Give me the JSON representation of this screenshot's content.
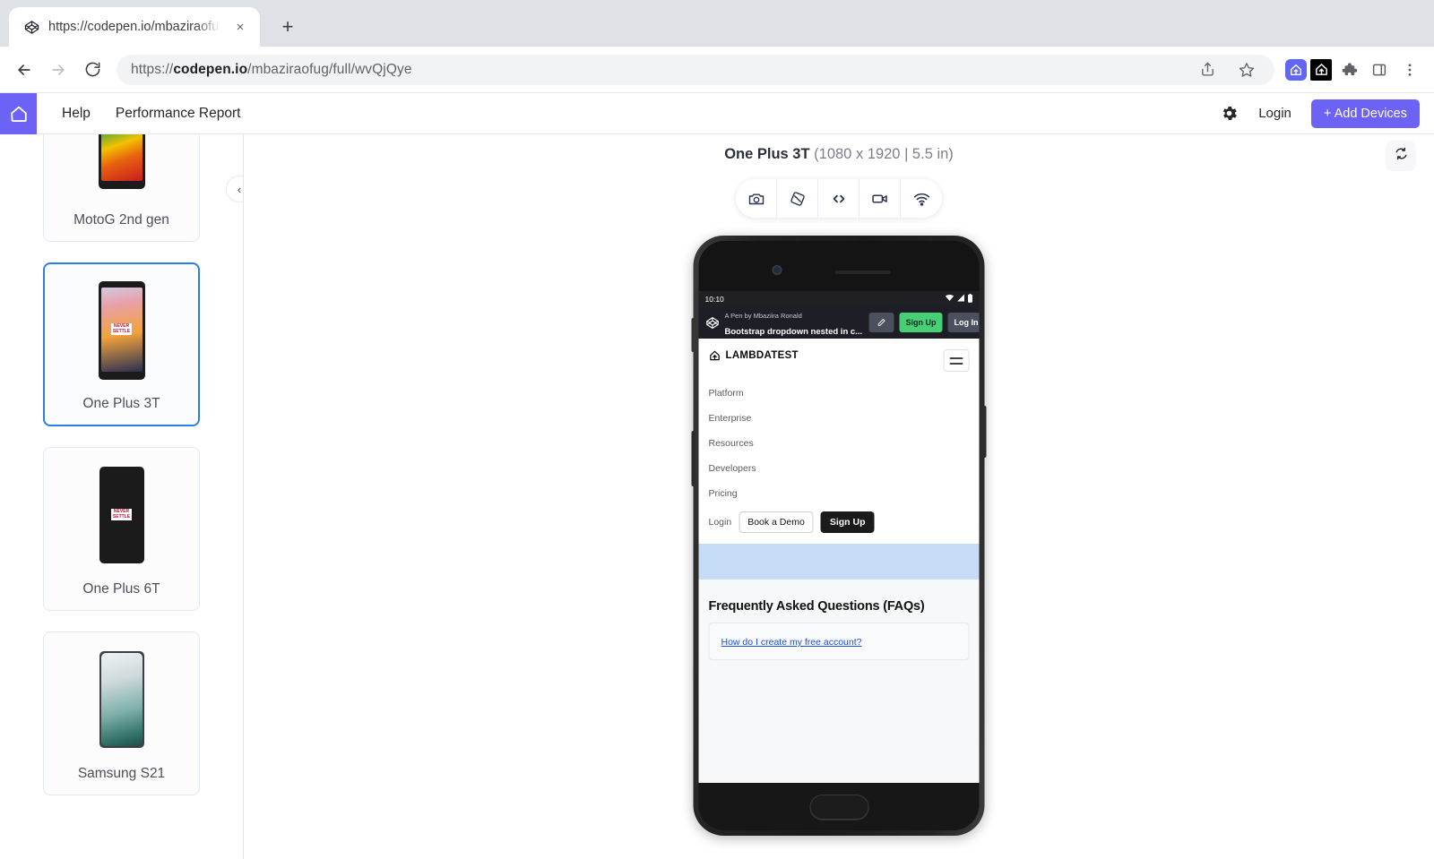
{
  "browser": {
    "tab": {
      "title": "https://codepen.io/mbaziraofug",
      "favicon": "codepen-icon",
      "close": "×"
    },
    "new_tab": "+",
    "nav": {
      "back": "←",
      "forward": "→",
      "reload": "⟳"
    },
    "address": {
      "prefix": "https://",
      "host": "codepen.io",
      "path": "/mbaziraofug/full/wvQjQye"
    },
    "actions": [
      "share-icon",
      "bookmark-star-icon",
      "lambdatest-extension-icon",
      "lambdatest-app-icon",
      "extensions-puzzle-icon",
      "side-panel-icon",
      "chrome-menu-icon"
    ]
  },
  "app_header": {
    "home_icon": "home-icon",
    "links": [
      "Help",
      "Performance Report"
    ],
    "settings_icon": "gear-icon",
    "login_label": "Login",
    "add_devices_label": "+ Add Devices",
    "accent": "#6c63f6"
  },
  "sidebar": {
    "collapse_icon": "‹",
    "devices": [
      {
        "label": "MotoG 2nd gen",
        "selected": false
      },
      {
        "label": "One Plus 3T",
        "selected": true
      },
      {
        "label": "One Plus 6T",
        "selected": false
      },
      {
        "label": "Samsung S21",
        "selected": false
      }
    ]
  },
  "stage": {
    "device_name": "One Plus 3T",
    "device_spec": "(1080 x 1920 | 5.5 in)",
    "toolbar": [
      {
        "name": "screenshot-icon",
        "label": "camera"
      },
      {
        "name": "rotate-icon",
        "label": "rotate"
      },
      {
        "name": "devtools-code-icon",
        "label": "<>"
      },
      {
        "name": "record-video-icon",
        "label": "video"
      },
      {
        "name": "network-wifi-icon",
        "label": "wifi"
      }
    ],
    "refresh_icon": "refresh-icon"
  },
  "device_screen": {
    "status_bar": {
      "time": "10:10",
      "icons": [
        "wifi-icon",
        "signal-icon",
        "battery-icon"
      ]
    },
    "codepen_bar": {
      "author": "A Pen by Mbaziira Ronald",
      "title": "Bootstrap dropdown nested in c...",
      "edit_label": "✎",
      "signup_label": "Sign Up",
      "login_label": "Log In",
      "signup_color": "#47cf73"
    },
    "site": {
      "logo_text": "LAMBDATEST",
      "menu": [
        "Platform",
        "Enterprise",
        "Resources",
        "Developers",
        "Pricing"
      ],
      "login_label": "Login",
      "demo_label": "Book a Demo",
      "signup_label": "Sign Up",
      "faq_title": "Frequently Asked Questions (FAQs)",
      "faq_items": [
        "How do I create my free account?"
      ],
      "band_color": "#c7dcf7"
    }
  }
}
